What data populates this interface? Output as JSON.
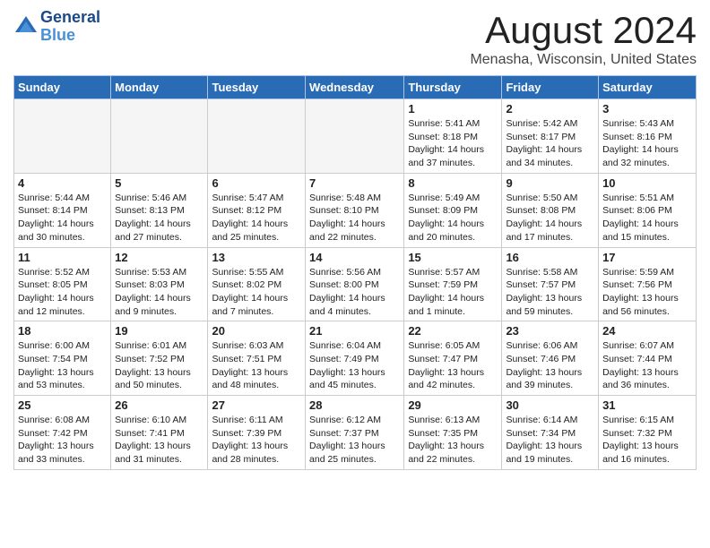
{
  "header": {
    "logo_line1": "General",
    "logo_line2": "Blue",
    "month_year": "August 2024",
    "location": "Menasha, Wisconsin, United States"
  },
  "weekdays": [
    "Sunday",
    "Monday",
    "Tuesday",
    "Wednesday",
    "Thursday",
    "Friday",
    "Saturday"
  ],
  "weeks": [
    [
      {
        "day": "",
        "info": ""
      },
      {
        "day": "",
        "info": ""
      },
      {
        "day": "",
        "info": ""
      },
      {
        "day": "",
        "info": ""
      },
      {
        "day": "1",
        "info": "Sunrise: 5:41 AM\nSunset: 8:18 PM\nDaylight: 14 hours\nand 37 minutes."
      },
      {
        "day": "2",
        "info": "Sunrise: 5:42 AM\nSunset: 8:17 PM\nDaylight: 14 hours\nand 34 minutes."
      },
      {
        "day": "3",
        "info": "Sunrise: 5:43 AM\nSunset: 8:16 PM\nDaylight: 14 hours\nand 32 minutes."
      }
    ],
    [
      {
        "day": "4",
        "info": "Sunrise: 5:44 AM\nSunset: 8:14 PM\nDaylight: 14 hours\nand 30 minutes."
      },
      {
        "day": "5",
        "info": "Sunrise: 5:46 AM\nSunset: 8:13 PM\nDaylight: 14 hours\nand 27 minutes."
      },
      {
        "day": "6",
        "info": "Sunrise: 5:47 AM\nSunset: 8:12 PM\nDaylight: 14 hours\nand 25 minutes."
      },
      {
        "day": "7",
        "info": "Sunrise: 5:48 AM\nSunset: 8:10 PM\nDaylight: 14 hours\nand 22 minutes."
      },
      {
        "day": "8",
        "info": "Sunrise: 5:49 AM\nSunset: 8:09 PM\nDaylight: 14 hours\nand 20 minutes."
      },
      {
        "day": "9",
        "info": "Sunrise: 5:50 AM\nSunset: 8:08 PM\nDaylight: 14 hours\nand 17 minutes."
      },
      {
        "day": "10",
        "info": "Sunrise: 5:51 AM\nSunset: 8:06 PM\nDaylight: 14 hours\nand 15 minutes."
      }
    ],
    [
      {
        "day": "11",
        "info": "Sunrise: 5:52 AM\nSunset: 8:05 PM\nDaylight: 14 hours\nand 12 minutes."
      },
      {
        "day": "12",
        "info": "Sunrise: 5:53 AM\nSunset: 8:03 PM\nDaylight: 14 hours\nand 9 minutes."
      },
      {
        "day": "13",
        "info": "Sunrise: 5:55 AM\nSunset: 8:02 PM\nDaylight: 14 hours\nand 7 minutes."
      },
      {
        "day": "14",
        "info": "Sunrise: 5:56 AM\nSunset: 8:00 PM\nDaylight: 14 hours\nand 4 minutes."
      },
      {
        "day": "15",
        "info": "Sunrise: 5:57 AM\nSunset: 7:59 PM\nDaylight: 14 hours\nand 1 minute."
      },
      {
        "day": "16",
        "info": "Sunrise: 5:58 AM\nSunset: 7:57 PM\nDaylight: 13 hours\nand 59 minutes."
      },
      {
        "day": "17",
        "info": "Sunrise: 5:59 AM\nSunset: 7:56 PM\nDaylight: 13 hours\nand 56 minutes."
      }
    ],
    [
      {
        "day": "18",
        "info": "Sunrise: 6:00 AM\nSunset: 7:54 PM\nDaylight: 13 hours\nand 53 minutes."
      },
      {
        "day": "19",
        "info": "Sunrise: 6:01 AM\nSunset: 7:52 PM\nDaylight: 13 hours\nand 50 minutes."
      },
      {
        "day": "20",
        "info": "Sunrise: 6:03 AM\nSunset: 7:51 PM\nDaylight: 13 hours\nand 48 minutes."
      },
      {
        "day": "21",
        "info": "Sunrise: 6:04 AM\nSunset: 7:49 PM\nDaylight: 13 hours\nand 45 minutes."
      },
      {
        "day": "22",
        "info": "Sunrise: 6:05 AM\nSunset: 7:47 PM\nDaylight: 13 hours\nand 42 minutes."
      },
      {
        "day": "23",
        "info": "Sunrise: 6:06 AM\nSunset: 7:46 PM\nDaylight: 13 hours\nand 39 minutes."
      },
      {
        "day": "24",
        "info": "Sunrise: 6:07 AM\nSunset: 7:44 PM\nDaylight: 13 hours\nand 36 minutes."
      }
    ],
    [
      {
        "day": "25",
        "info": "Sunrise: 6:08 AM\nSunset: 7:42 PM\nDaylight: 13 hours\nand 33 minutes."
      },
      {
        "day": "26",
        "info": "Sunrise: 6:10 AM\nSunset: 7:41 PM\nDaylight: 13 hours\nand 31 minutes."
      },
      {
        "day": "27",
        "info": "Sunrise: 6:11 AM\nSunset: 7:39 PM\nDaylight: 13 hours\nand 28 minutes."
      },
      {
        "day": "28",
        "info": "Sunrise: 6:12 AM\nSunset: 7:37 PM\nDaylight: 13 hours\nand 25 minutes."
      },
      {
        "day": "29",
        "info": "Sunrise: 6:13 AM\nSunset: 7:35 PM\nDaylight: 13 hours\nand 22 minutes."
      },
      {
        "day": "30",
        "info": "Sunrise: 6:14 AM\nSunset: 7:34 PM\nDaylight: 13 hours\nand 19 minutes."
      },
      {
        "day": "31",
        "info": "Sunrise: 6:15 AM\nSunset: 7:32 PM\nDaylight: 13 hours\nand 16 minutes."
      }
    ]
  ]
}
